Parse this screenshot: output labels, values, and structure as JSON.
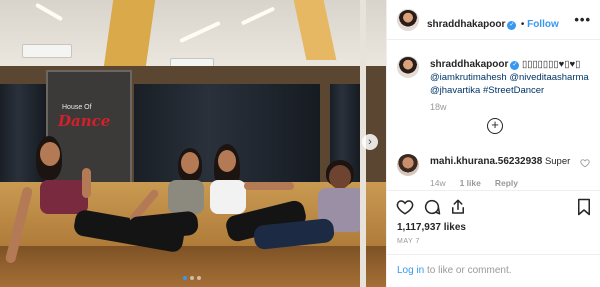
{
  "post": {
    "username": "shraddhakapoor",
    "follow_label": "Follow",
    "more_label": "•••",
    "verified_glyph": "✓",
    "logo_small": "House Of",
    "logo_text": "Dance",
    "carousel": {
      "slide_count": 3,
      "active_slide": 1
    },
    "next_glyph": "›"
  },
  "caption": {
    "username": "shraddhakapoor",
    "emoji_text": "▯▯▯▯▯▯▯♥▯♥▯",
    "mentions": [
      "@iamkrutimahesh",
      "@niveditaasharma",
      "@jhavartika",
      "#StreetDancer"
    ],
    "time": "18w"
  },
  "load_more": {
    "glyph": "+"
  },
  "comments": [
    {
      "username": "mahi.khurana.56232938",
      "text": "Super",
      "time": "14w",
      "likes_label": "1 like",
      "reply_label": "Reply"
    }
  ],
  "actions": {
    "likes_label": "1,117,937 likes",
    "date": "MAY 7"
  },
  "login": {
    "link_text": "Log in",
    "suffix": "to like or comment."
  },
  "icons": {
    "like": "heart-icon",
    "comment": "comment-icon",
    "share": "share-icon",
    "save": "bookmark-icon",
    "more": "more-options-icon",
    "next": "chevron-right-icon",
    "add": "plus-circle-icon"
  },
  "colors": {
    "accent": "#3897f0",
    "text": "#262626",
    "muted": "#999999",
    "border": "#efefef"
  }
}
